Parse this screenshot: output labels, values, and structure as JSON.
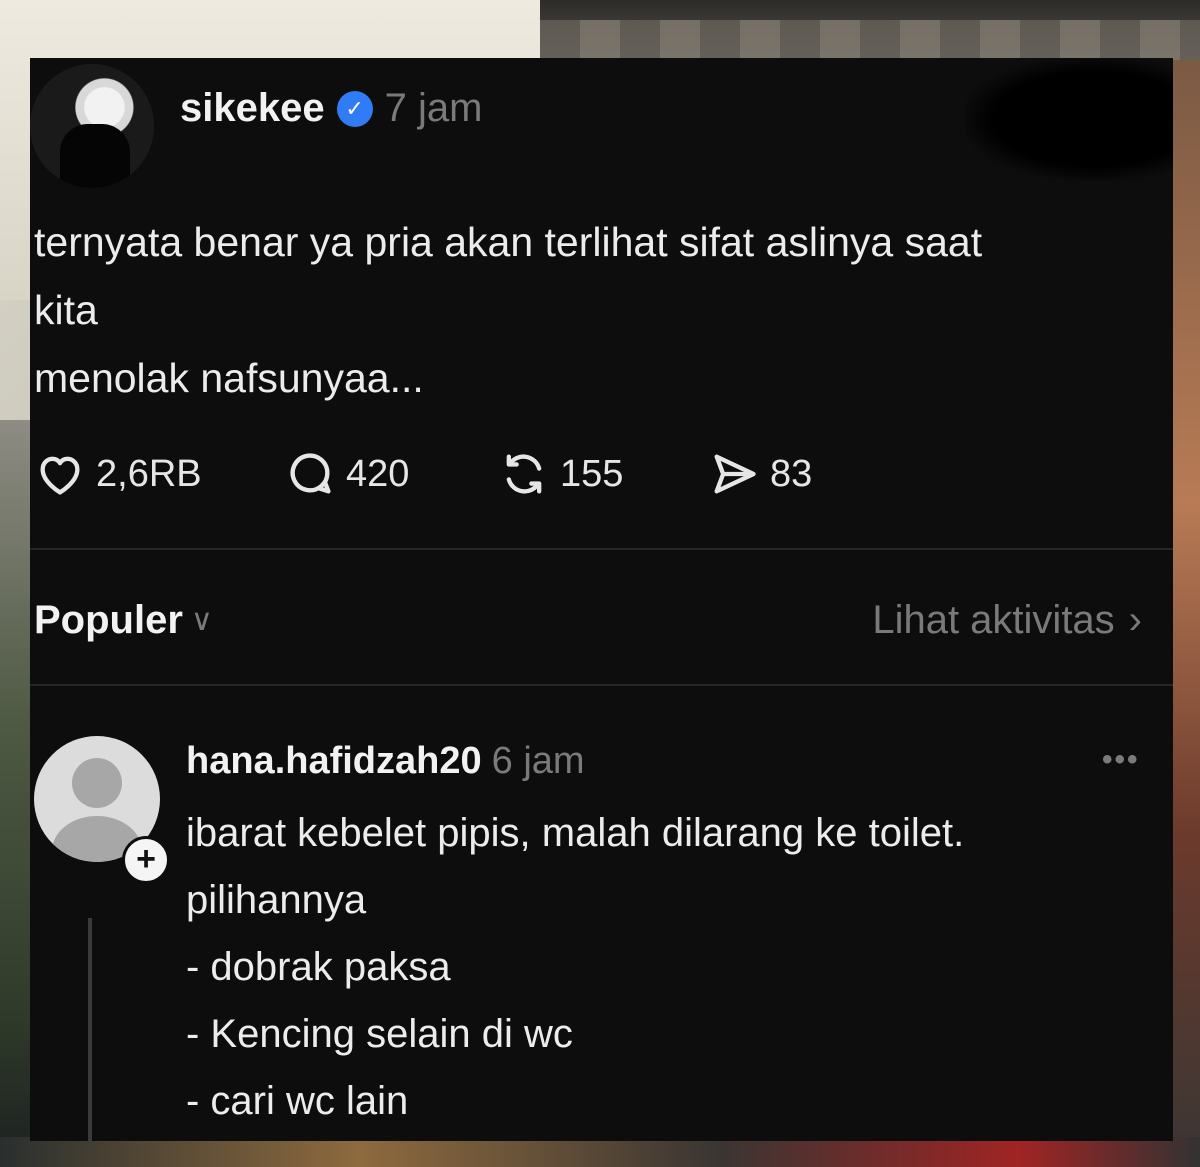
{
  "post": {
    "author": "sikekee",
    "verified_icon": "verified-badge-icon",
    "time": "7 jam",
    "text": "ternyata benar ya pria akan terlihat sifat aslinya saat\nkita\nmenolak nafsunyaa...",
    "stats": {
      "likes": "2,6RB",
      "comments": "420",
      "reposts": "155",
      "shares": "83"
    }
  },
  "replies_header": {
    "sort_label": "Populer",
    "activity_link": "Lihat aktivitas"
  },
  "comment": {
    "author": "hana.hafidzah20",
    "time": "6 jam",
    "text": "ibarat kebelet pipis, malah dilarang ke toilet.\npilihannya\n- dobrak paksa\n- Kencing selain di wc\n- cari wc lain",
    "more_label": "•••"
  },
  "colors": {
    "background": "#0d0d0d",
    "verified": "#2f7cf6",
    "muted_text": "#7a7a7a",
    "primary_text": "#ececec"
  }
}
